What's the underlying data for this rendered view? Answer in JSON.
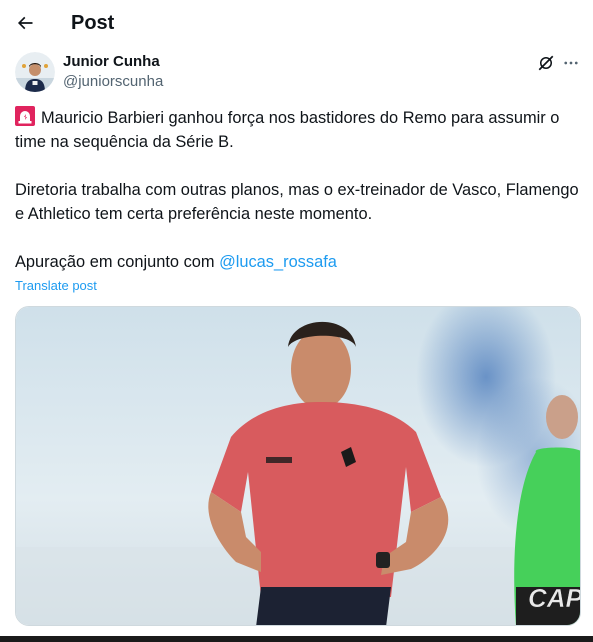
{
  "header": {
    "title": "Post",
    "back_icon": "arrow-left-icon"
  },
  "author": {
    "name": "Junior Cunha",
    "handle": "@juniorscunha",
    "avatar_icon": "avatar"
  },
  "actions": {
    "grok_icon": "grok-icon",
    "more_icon": "more-horizontal-icon"
  },
  "post": {
    "line1": "Mauricio Barbieri ganhou força nos bastidores do Remo para assumir o time na sequência da Série B.",
    "line2": "Diretoria trabalha com outras planos, mas o ex-treinador de Vasco, Flamengo e Athletico tem certa preferência neste momento.",
    "line3_prefix": "Apuração em conjunto com ",
    "mention": "@lucas_rossafa",
    "emoji_icon": "siren-icon"
  },
  "translate_label": "Translate post",
  "media": {
    "watermark_icon": "cap-logo"
  },
  "colors": {
    "accent": "#1d9bf0",
    "text": "#0f1419",
    "muted": "#536471"
  }
}
